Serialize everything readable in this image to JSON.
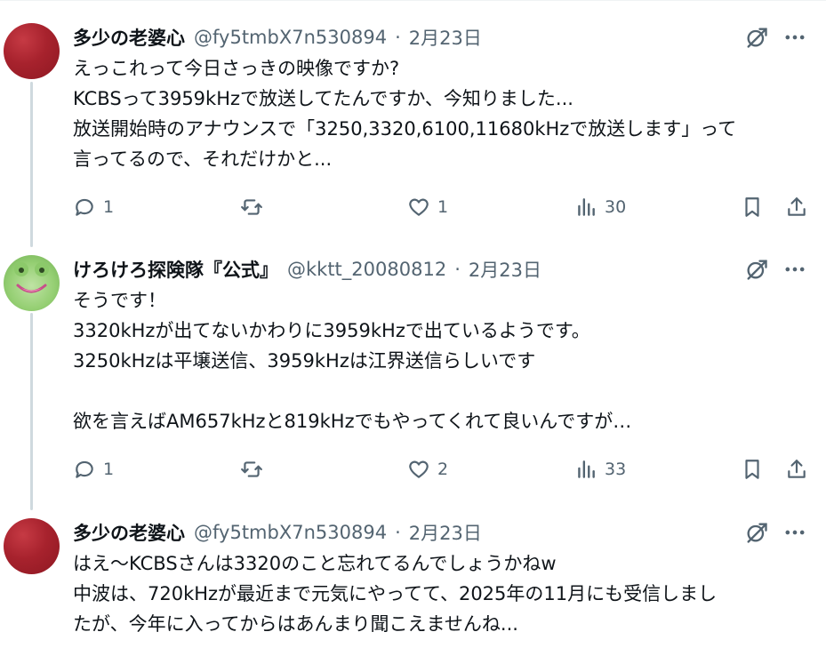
{
  "tweets": [
    {
      "name": "多少の老婆心",
      "handle": "@fy5tmbX7n530894",
      "separator": "·",
      "date": "2月23日",
      "lines": [
        "えっこれって今日さっきの映像ですか?",
        "KCBSって3959kHzで放送してたんですか、今知りました...",
        "放送開始時のアナウンスで「3250,3320,6100,11680kHzで放送します」って",
        "言ってるので、それだけかと..."
      ],
      "replies": "1",
      "likes": "1",
      "views": "30"
    },
    {
      "name": "けろけろ探険隊『公式』",
      "handle": "@kktt_20080812",
      "separator": "·",
      "date": "2月23日",
      "lines": [
        "そうです！",
        "3320kHzが出てないかわりに3959kHzで出ているようです。",
        "3250kHzは平壌送信、3959kHzは江界送信らしいです",
        "",
        "欲を言えばAM657kHzと819kHzでもやってくれて良いんですが…"
      ],
      "replies": "1",
      "likes": "2",
      "views": "33"
    },
    {
      "name": "多少の老婆心",
      "handle": "@fy5tmbX7n530894",
      "separator": "·",
      "date": "2月23日",
      "lines": [
        "はえ〜KCBSさんは3320のこと忘れてるんでしょうかねw",
        "中波は、720kHzが最近まで元気にやってて、2025年の11月にも受信しまし",
        "たが、今年に入ってからはあんまり聞こえませんね..."
      ]
    }
  ],
  "icons": {
    "reply": "reply-icon",
    "retweet": "retweet-icon",
    "like": "like-icon",
    "views": "views-icon",
    "bookmark": "bookmark-icon",
    "share": "share-icon",
    "grok": "grok-icon",
    "more": "more-icon"
  },
  "colors": {
    "text": "#0f1419",
    "secondary": "#536471",
    "thread_line": "#cfd9de"
  }
}
